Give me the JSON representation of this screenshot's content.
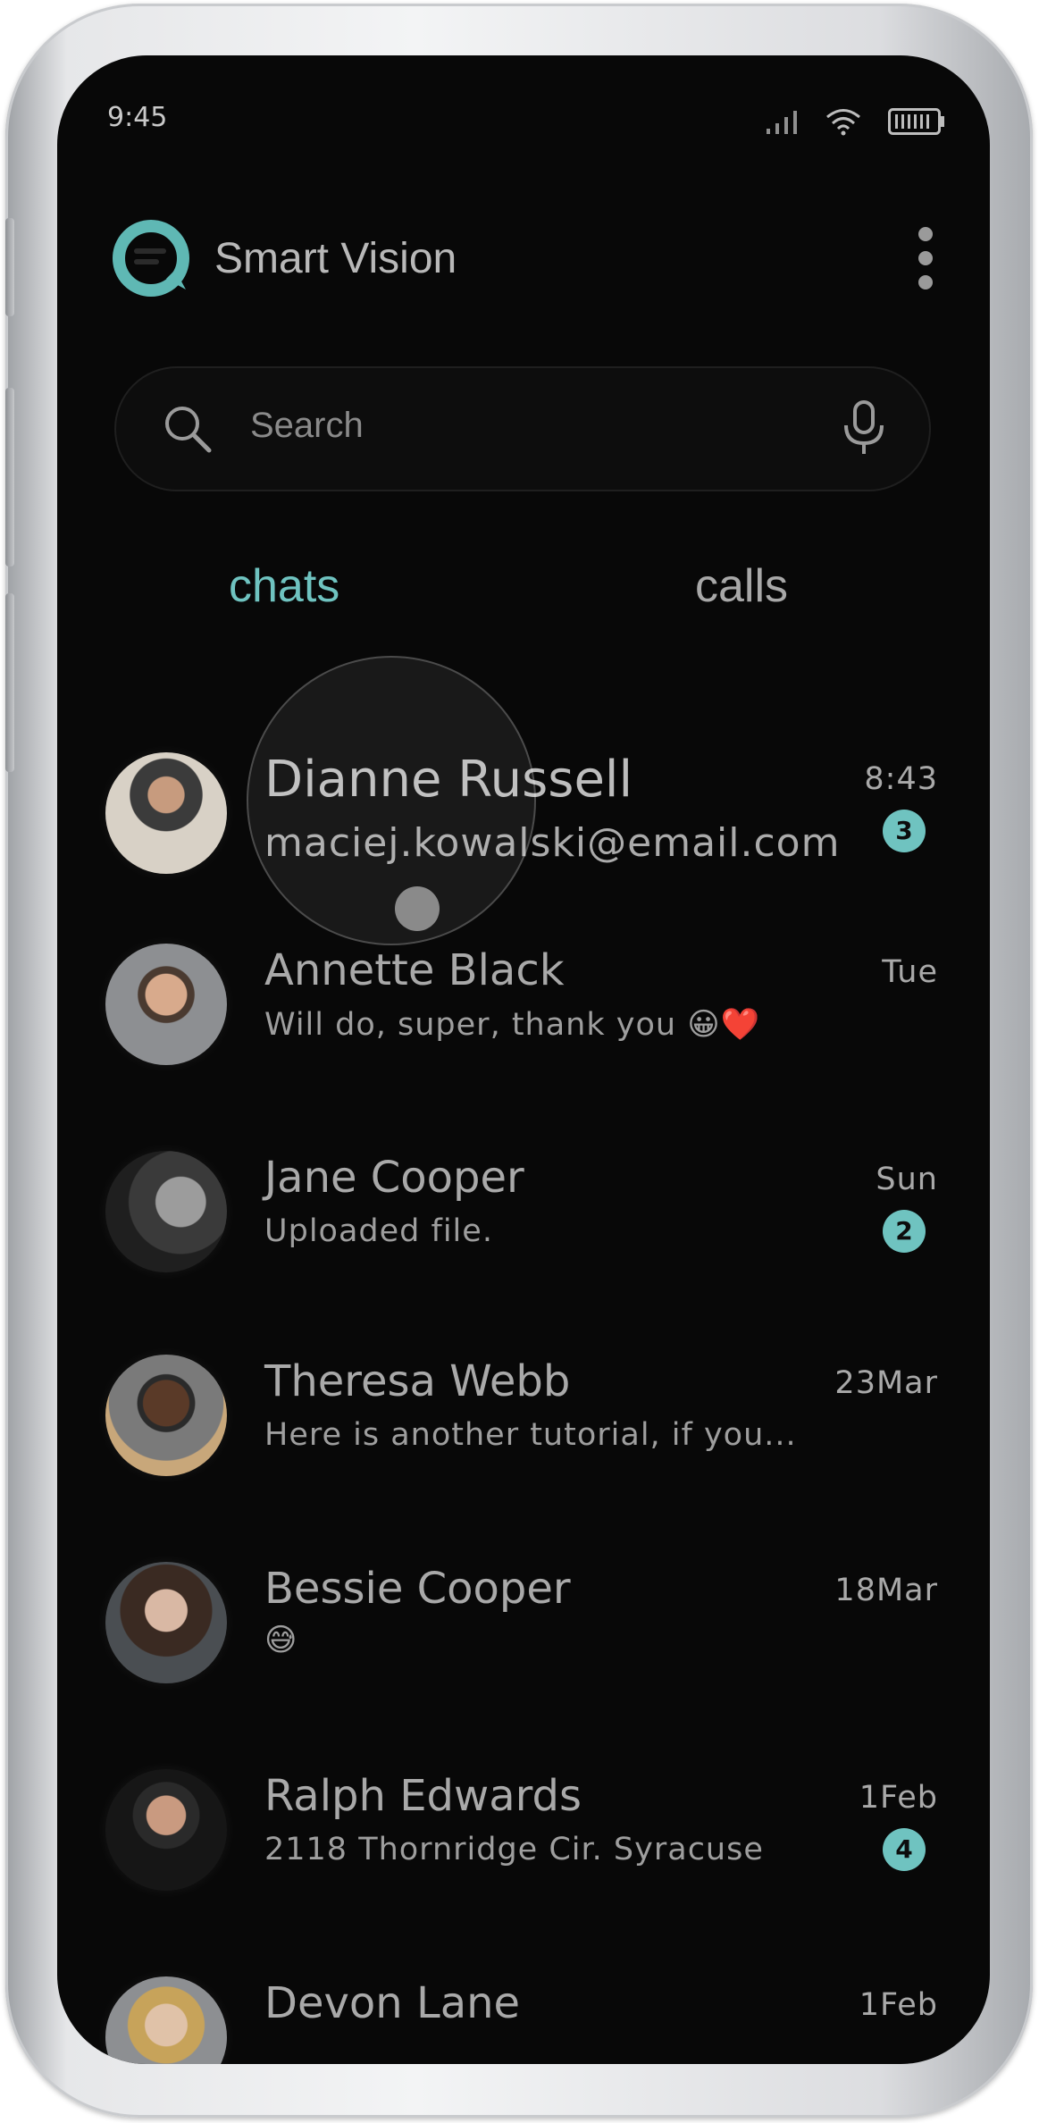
{
  "status": {
    "time": "9:45"
  },
  "header": {
    "title": "Smart Vision"
  },
  "search": {
    "placeholder": "Search"
  },
  "tabs": {
    "chats": "chats",
    "calls": "calls"
  },
  "accent_color": "#6fc3c0",
  "chats": [
    {
      "name": "Dianne Russell",
      "message": "maciej.kowalski@email.com",
      "time": "8:43",
      "badge": "3"
    },
    {
      "name": "Annette Black",
      "message": "Will do, super, thank you",
      "emoji": "😀❤️",
      "time": "Tue",
      "badge": ""
    },
    {
      "name": "Jane Cooper",
      "message": "Uploaded file.",
      "time": "Sun",
      "badge": "2"
    },
    {
      "name": "Theresa Webb",
      "message": "Here is another tutorial, if you...",
      "time": "23Mar",
      "badge": ""
    },
    {
      "name": "Bessie Cooper",
      "message": "",
      "emoji": "😅",
      "time": "18Mar",
      "badge": ""
    },
    {
      "name": "Ralph Edwards",
      "message": "2118 Thornridge Cir. Syracuse",
      "time": "1Feb",
      "badge": "4"
    },
    {
      "name": "Devon Lane",
      "message": "",
      "time": "1Feb",
      "badge": ""
    }
  ]
}
